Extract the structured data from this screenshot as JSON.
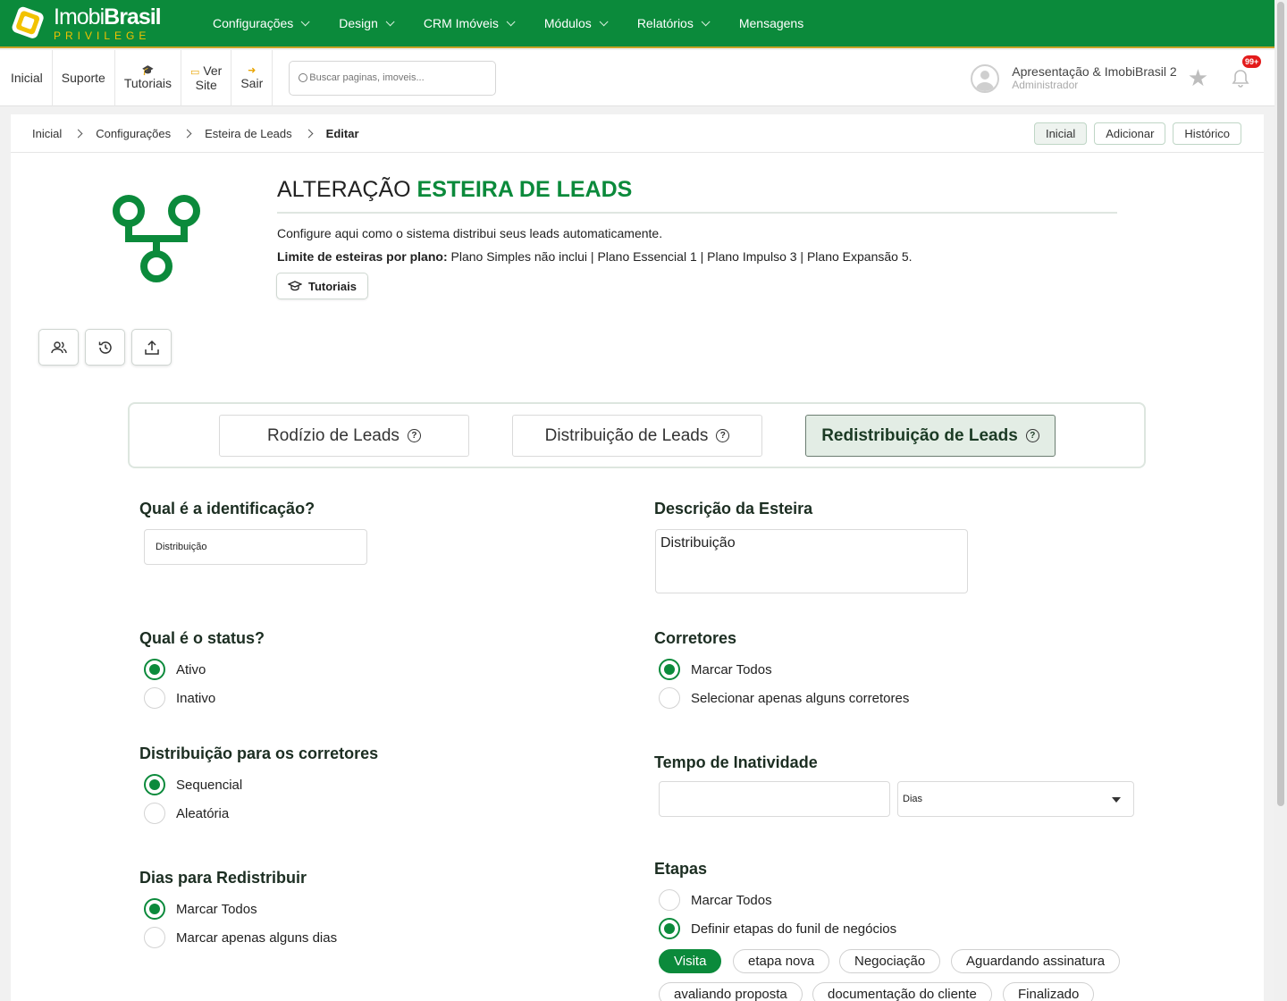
{
  "brand": {
    "name_light": "Imobi",
    "name_bold": "Brasil",
    "tagline": "PRIVILEGE"
  },
  "menu": [
    "Configurações",
    "Design",
    "CRM Imóveis",
    "Módulos",
    "Relatórios",
    "Mensagens"
  ],
  "subbar": {
    "inicial": "Inicial",
    "suporte": "Suporte",
    "tutoriais": "Tutoriais",
    "ver": "Ver",
    "site": "Site",
    "sair": "Sair",
    "search_placeholder": "Buscar paginas, imoveis..."
  },
  "user": {
    "name": "Apresentação & ImobiBrasil 2",
    "role": "Administrador",
    "notifications": "99+"
  },
  "breadcrumb": [
    "Inicial",
    "Configurações",
    "Esteira de Leads",
    "Editar"
  ],
  "crumb_actions": {
    "inicial": "Inicial",
    "adicionar": "Adicionar",
    "historico": "Histórico"
  },
  "header": {
    "title_prefix": "ALTERAÇÃO",
    "title_highlight": "ESTEIRA DE LEADS",
    "description": "Configure aqui como o sistema distribui seus leads automaticamente.",
    "limits_label": "Limite de esteiras por plano:",
    "limits_text": " Plano Simples não inclui | Plano Essencial 1 | Plano Impulso 3 | Plano Expansão 5.",
    "tutorials_button": "Tutoriais"
  },
  "tabs": [
    "Rodízio de Leads",
    "Distribuição de Leads",
    "Redistribuição de Leads"
  ],
  "active_tab": "Redistribuição de Leads",
  "form": {
    "identificacao": {
      "label": "Qual é a identificação?",
      "value": "Distribuição"
    },
    "descricao": {
      "label": "Descrição da Esteira",
      "value": "Distribuição"
    },
    "status": {
      "label": "Qual é o status?",
      "options": [
        "Ativo",
        "Inativo"
      ],
      "selected": "Ativo"
    },
    "corretores": {
      "label": "Corretores",
      "options": [
        "Marcar Todos",
        "Selecionar apenas alguns corretores"
      ],
      "selected": "Marcar Todos"
    },
    "distribuicao": {
      "label": "Distribuição para os corretores",
      "options": [
        "Sequencial",
        "Aleatória"
      ],
      "selected": "Sequencial"
    },
    "inatividade": {
      "label": "Tempo de Inatividade",
      "value": "",
      "unit": "Dias"
    },
    "dias": {
      "label": "Dias para Redistribuir",
      "options": [
        "Marcar Todos",
        "Marcar apenas alguns dias"
      ],
      "selected": "Marcar Todos"
    },
    "etapas": {
      "label": "Etapas",
      "options": [
        "Marcar Todos",
        "Definir etapas do funil de negócios"
      ],
      "selected": "Definir etapas do funil de negócios",
      "chips": [
        "Visita",
        "etapa nova",
        "Negociação",
        "Aguardando assinatura",
        "avaliando proposta",
        "documentação do cliente",
        "Finalizado"
      ],
      "selected_chip": "Visita"
    }
  },
  "colors": {
    "brand_green": "#0b8a3b",
    "accent_gold": "#f2c200",
    "badge_red": "#e31b1b"
  }
}
